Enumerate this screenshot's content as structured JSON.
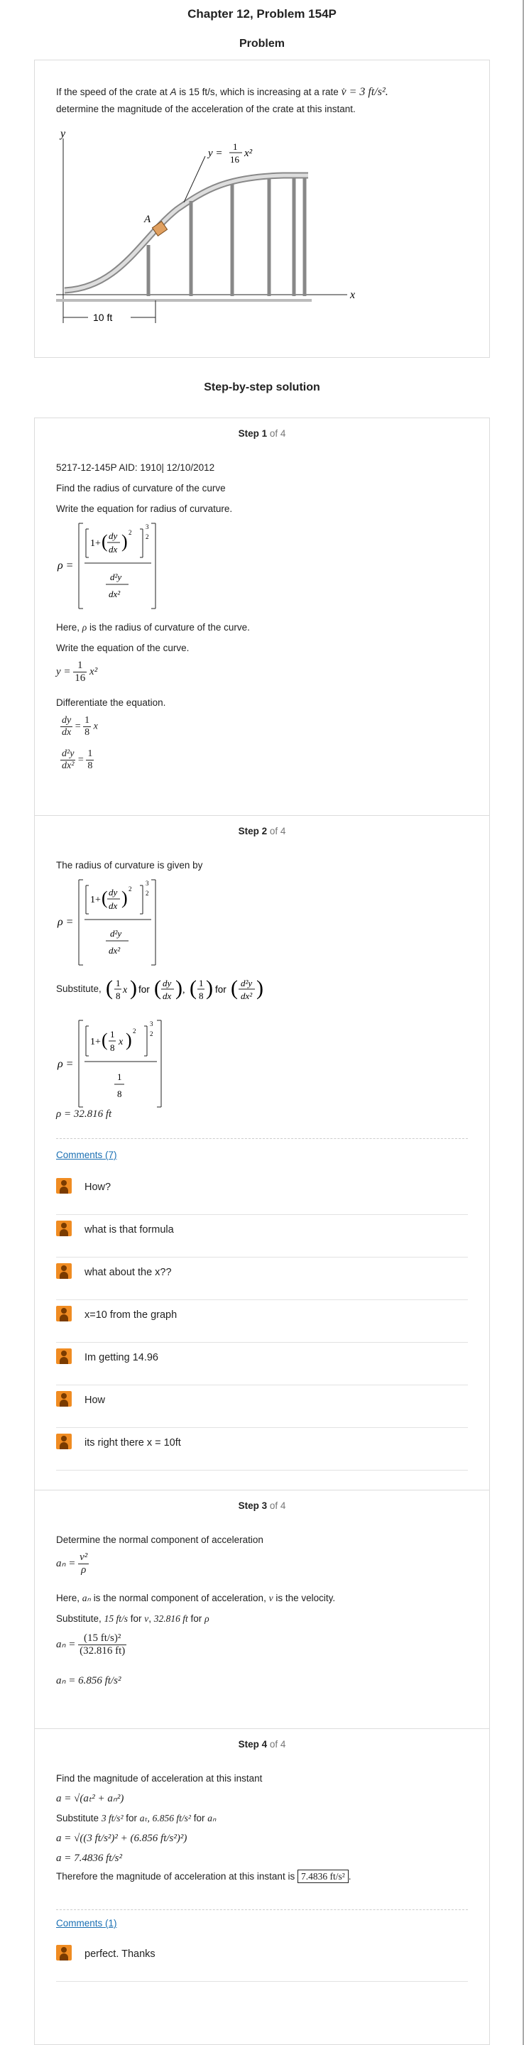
{
  "title": "Chapter 12, Problem 154P",
  "problem_heading": "Problem",
  "problem": {
    "text_a": "If the speed of the crate at ",
    "text_A": "A",
    "text_b": " is 15 ft/s, which is increasing at a rate ",
    "rate": "v̇ = 3 ft/s².",
    "text_c": "determine the magnitude of the acceleration of the crate at this instant.",
    "figure": {
      "y_axis": "y",
      "x_axis": "x",
      "curve_eq_prefix": "y =",
      "curve_eq_num": "1",
      "curve_eq_den": "16",
      "curve_eq_suffix": "x²",
      "point": "A",
      "dimension": "10 ft"
    }
  },
  "solution_heading": "Step-by-step solution",
  "steps": [
    {
      "label": "Step 1",
      "of": " of 4",
      "aid": "5217-12-145P AID: 1910| 12/10/2012",
      "find": "Find the radius of curvature of the curve",
      "write_r": "Write the equation for radius of curvature.",
      "here": "Here,",
      "rho": "ρ",
      "here_rest": "is the radius of curvature of the curve.",
      "write_curve": "Write the equation of the curve.",
      "curve_lhs": "y =",
      "curve_num": "1",
      "curve_den": "16",
      "curve_x": "x²",
      "diff": "Differentiate the equation.",
      "d1_num": "dy",
      "d1_den": "dx",
      "d1_eq": "=",
      "d1_rnum": "1",
      "d1_rden": "8",
      "d1_x": "x",
      "d2_num": "d²y",
      "d2_den": "dx²",
      "d2_eq": "=",
      "d2_rnum": "1",
      "d2_rden": "8"
    },
    {
      "label": "Step 2",
      "of": " of 4",
      "intro": "The radius of curvature is given by",
      "subst": "Substitute,",
      "for": "for",
      "result": "ρ = 32.816 ft",
      "comments_link": "Comments (7)",
      "comments": [
        "How?",
        "what is that formula",
        "what about the x??",
        "x=10 from the graph",
        "Im getting 14.96",
        "How",
        "its right there x = 10ft"
      ]
    },
    {
      "label": "Step 3",
      "of": " of 4",
      "intro": "Determine the normal component of acceleration",
      "an_lhs": "aₙ =",
      "an_num": "v²",
      "an_den": "ρ",
      "here": "Here,",
      "an": "aₙ",
      "here_mid": "is the normal component of acceleration,",
      "v": "v",
      "here_end": "is the velocity.",
      "subst": "Substitute,",
      "sub_a": "15 ft/s",
      "sub_for1": "for",
      "sub_v": "v",
      "sub_b": "32.816 ft",
      "sub_for2": "for",
      "sub_rho": "ρ",
      "calc_num": "(15 ft/s)²",
      "calc_den": "(32.816 ft)",
      "result": "aₙ = 6.856 ft/s²"
    },
    {
      "label": "Step 4",
      "of": " of 4",
      "intro": "Find the magnitude of acceleration at this instant",
      "formula": "a = √(aₜ² + aₙ²)",
      "subst": "Substitute",
      "sub_a": "3 ft/s²",
      "sub_for1": "for",
      "sub_at": "aₜ,",
      "sub_b": "6.856 ft/s²",
      "sub_for2": "for",
      "sub_an": "aₙ",
      "calc": "a = √((3 ft/s²)² + (6.856 ft/s²)²)",
      "result": "a = 7.4836 ft/s²",
      "therefore": "Therefore the magnitude of acceleration at this instant is",
      "answer": "7.4836 ft/s²",
      "period": ".",
      "comments_link": "Comments (1)",
      "comments": [
        "perfect. Thanks"
      ]
    }
  ]
}
